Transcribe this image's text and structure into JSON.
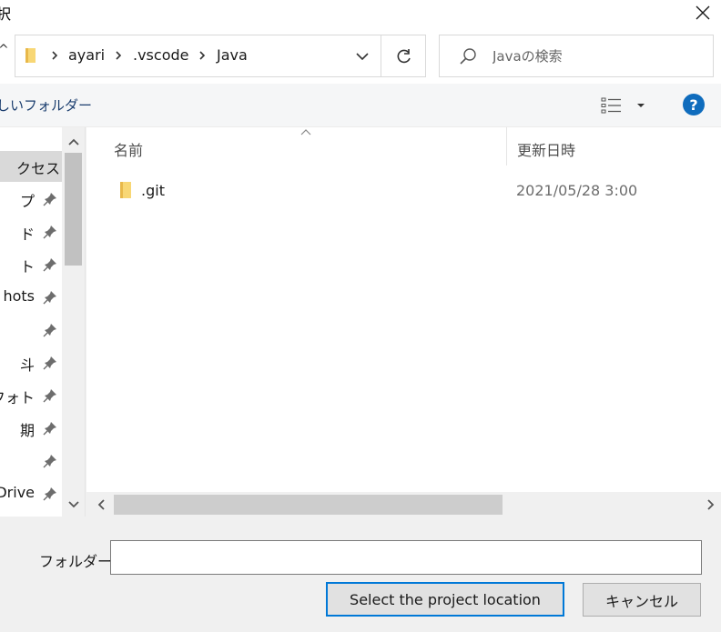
{
  "window": {
    "title": "択"
  },
  "address": {
    "up_glyph": "^",
    "breadcrumbs": [
      "ayari",
      ".vscode",
      "Java"
    ]
  },
  "search": {
    "placeholder": "Javaの検索"
  },
  "toolbar": {
    "new_folder_label": "しいフォルダー",
    "help_label": "?"
  },
  "nav": {
    "items": [
      {
        "label": "クセス",
        "pinned": false,
        "selected": true
      },
      {
        "label": "プ",
        "pinned": true
      },
      {
        "label": "ド",
        "pinned": true
      },
      {
        "label": "ト",
        "pinned": true
      },
      {
        "label": "hots",
        "pinned": true
      },
      {
        "label": "",
        "pinned": true
      },
      {
        "label": "斗",
        "pinned": true
      },
      {
        "label": "フォト",
        "pinned": true
      },
      {
        "label": "期",
        "pinned": true
      },
      {
        "label": "",
        "pinned": true
      },
      {
        "label": "Drive",
        "pinned": true
      }
    ]
  },
  "filelist": {
    "columns": {
      "name": "名前",
      "date": "更新日時"
    },
    "files": [
      {
        "name": ".git",
        "date": "2021/05/28 3:00",
        "icon": "folder-icon"
      }
    ]
  },
  "footer": {
    "folder_label": "フォルダー:",
    "folder_value": "",
    "select_label": "Select the project location",
    "cancel_label": "キャンセル"
  },
  "colors": {
    "accent": "#0078d7",
    "help": "#0f6cbd",
    "folder": "#f8d775",
    "selected_nav": "#d9d9d9"
  }
}
